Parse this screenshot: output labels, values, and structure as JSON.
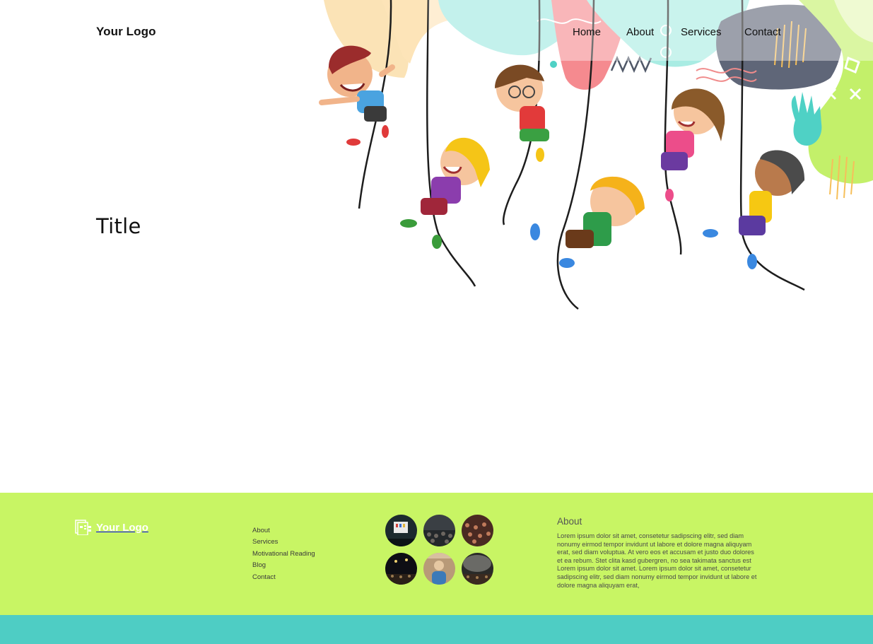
{
  "header": {
    "logo_text": "Your Logo",
    "nav": [
      {
        "label": "Home",
        "id": "home"
      },
      {
        "label": "About",
        "id": "about"
      },
      {
        "label": "Services",
        "id": "services"
      },
      {
        "label": "Contact",
        "id": "contact"
      }
    ]
  },
  "hero": {
    "title": "Title",
    "illustration": "kids-climbing-ropes-illustration"
  },
  "footer": {
    "logo_text": "Your Logo",
    "logo_icon": "logo-icon",
    "links": [
      "About",
      "Services",
      "Motivational Reading",
      "Blog",
      "Contact"
    ],
    "gallery": [
      {
        "name": "gallery-thumb-presentation"
      },
      {
        "name": "gallery-thumb-crowd"
      },
      {
        "name": "gallery-thumb-audience"
      },
      {
        "name": "gallery-thumb-concert"
      },
      {
        "name": "gallery-thumb-speaker"
      },
      {
        "name": "gallery-thumb-hall"
      }
    ],
    "about": {
      "heading": "About",
      "text": "Lorem ipsum dolor sit amet, consetetur sadipscing elitr, sed diam nonumy eirmod tempor invidunt ut labore et dolore magna aliquyam erat, sed diam voluptua. At vero eos et accusam et justo duo dolores et ea rebum. Stet clita kasd gubergren, no sea takimata sanctus est Lorem ipsum dolor sit amet. Lorem ipsum dolor sit amet, consetetur sadipscing elitr, sed diam nonumy eirmod tempor invidunt ut labore et dolore magna aliquyam erat,"
    }
  },
  "colors": {
    "footer_bg": "#c8f564",
    "bottom_bar": "#4ecdc4",
    "accent_orange": "#fbd9a6",
    "accent_teal": "#6fe0d6",
    "accent_pink": "#f47a80",
    "accent_lime": "#b6ea4b"
  }
}
